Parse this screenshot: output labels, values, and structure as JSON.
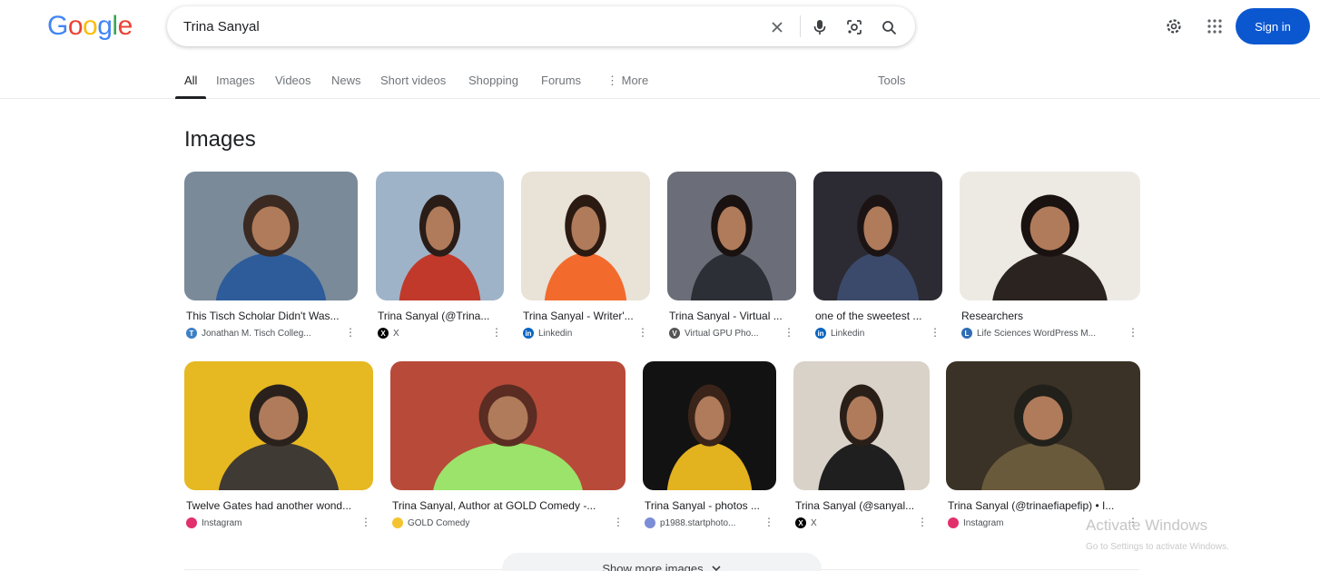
{
  "brand": {
    "logo_letters": [
      "G",
      "o",
      "o",
      "g",
      "l",
      "e"
    ],
    "logo_colors": [
      "#4285f4",
      "#ea4335",
      "#fbbc05",
      "#4285f4",
      "#34a853",
      "#ea4335"
    ]
  },
  "search": {
    "value": "Trina Sanyal",
    "icons": [
      "close-icon",
      "mic-icon",
      "lens-icon",
      "search-icon"
    ]
  },
  "header": {
    "settings_icon": "gear-icon",
    "apps_icon": "apps-grid-icon",
    "sign_in_label": "Sign in",
    "accent": "#0b57d0"
  },
  "tabs": {
    "items": [
      "All",
      "Images",
      "Videos",
      "News",
      "Short videos",
      "Shopping",
      "Forums",
      "⋮ More"
    ],
    "active": "All",
    "tools": "Tools"
  },
  "images": {
    "title": "Images",
    "row1": [
      {
        "title": "This Tisch Scholar Didn't Was...",
        "source": "Jonathan M. Tisch Colleg...",
        "favicon": "T",
        "fav_color": "#3d7fc4"
      },
      {
        "title": "Trina Sanyal (@Trina...",
        "source": "X",
        "favicon": "X",
        "fav_color": "#000000"
      },
      {
        "title": "Trina Sanyal - Writer'...",
        "source": "Linkedin",
        "favicon": "in",
        "fav_color": "#0a66c2"
      },
      {
        "title": "Trina Sanyal - Virtual ...",
        "source": "Virtual GPU Pho...",
        "favicon": "V",
        "fav_color": "#555555"
      },
      {
        "title": "one of the sweetest ...",
        "source": "Linkedin",
        "favicon": "in",
        "fav_color": "#0a66c2"
      },
      {
        "title": "Researchers",
        "source": "Life Sciences WordPress M...",
        "favicon": "L",
        "fav_color": "#2f6db5"
      }
    ],
    "row2": [
      {
        "title": "Twelve Gates had another wond...",
        "source": "Instagram",
        "favicon": "",
        "fav_color": "#e1306c"
      },
      {
        "title": "Trina Sanyal, Author at GOLD Comedy -...",
        "source": "GOLD Comedy",
        "favicon": "",
        "fav_color": "#f4c430"
      },
      {
        "title": "Trina Sanyal - photos ...",
        "source": "p1988.startphoto...",
        "favicon": "",
        "fav_color": "#7b8dd6"
      },
      {
        "title": "Trina Sanyal (@sanyal...",
        "source": "X",
        "favicon": "X",
        "fav_color": "#000000"
      },
      {
        "title": "Trina Sanyal (@trinaefiapefip) • I...",
        "source": "Instagram",
        "favicon": "",
        "fav_color": "#e1306c"
      }
    ],
    "show_more": "Show more images"
  },
  "watermark": {
    "line1": "Activate Windows",
    "line2": "Go to Settings to activate Windows."
  }
}
